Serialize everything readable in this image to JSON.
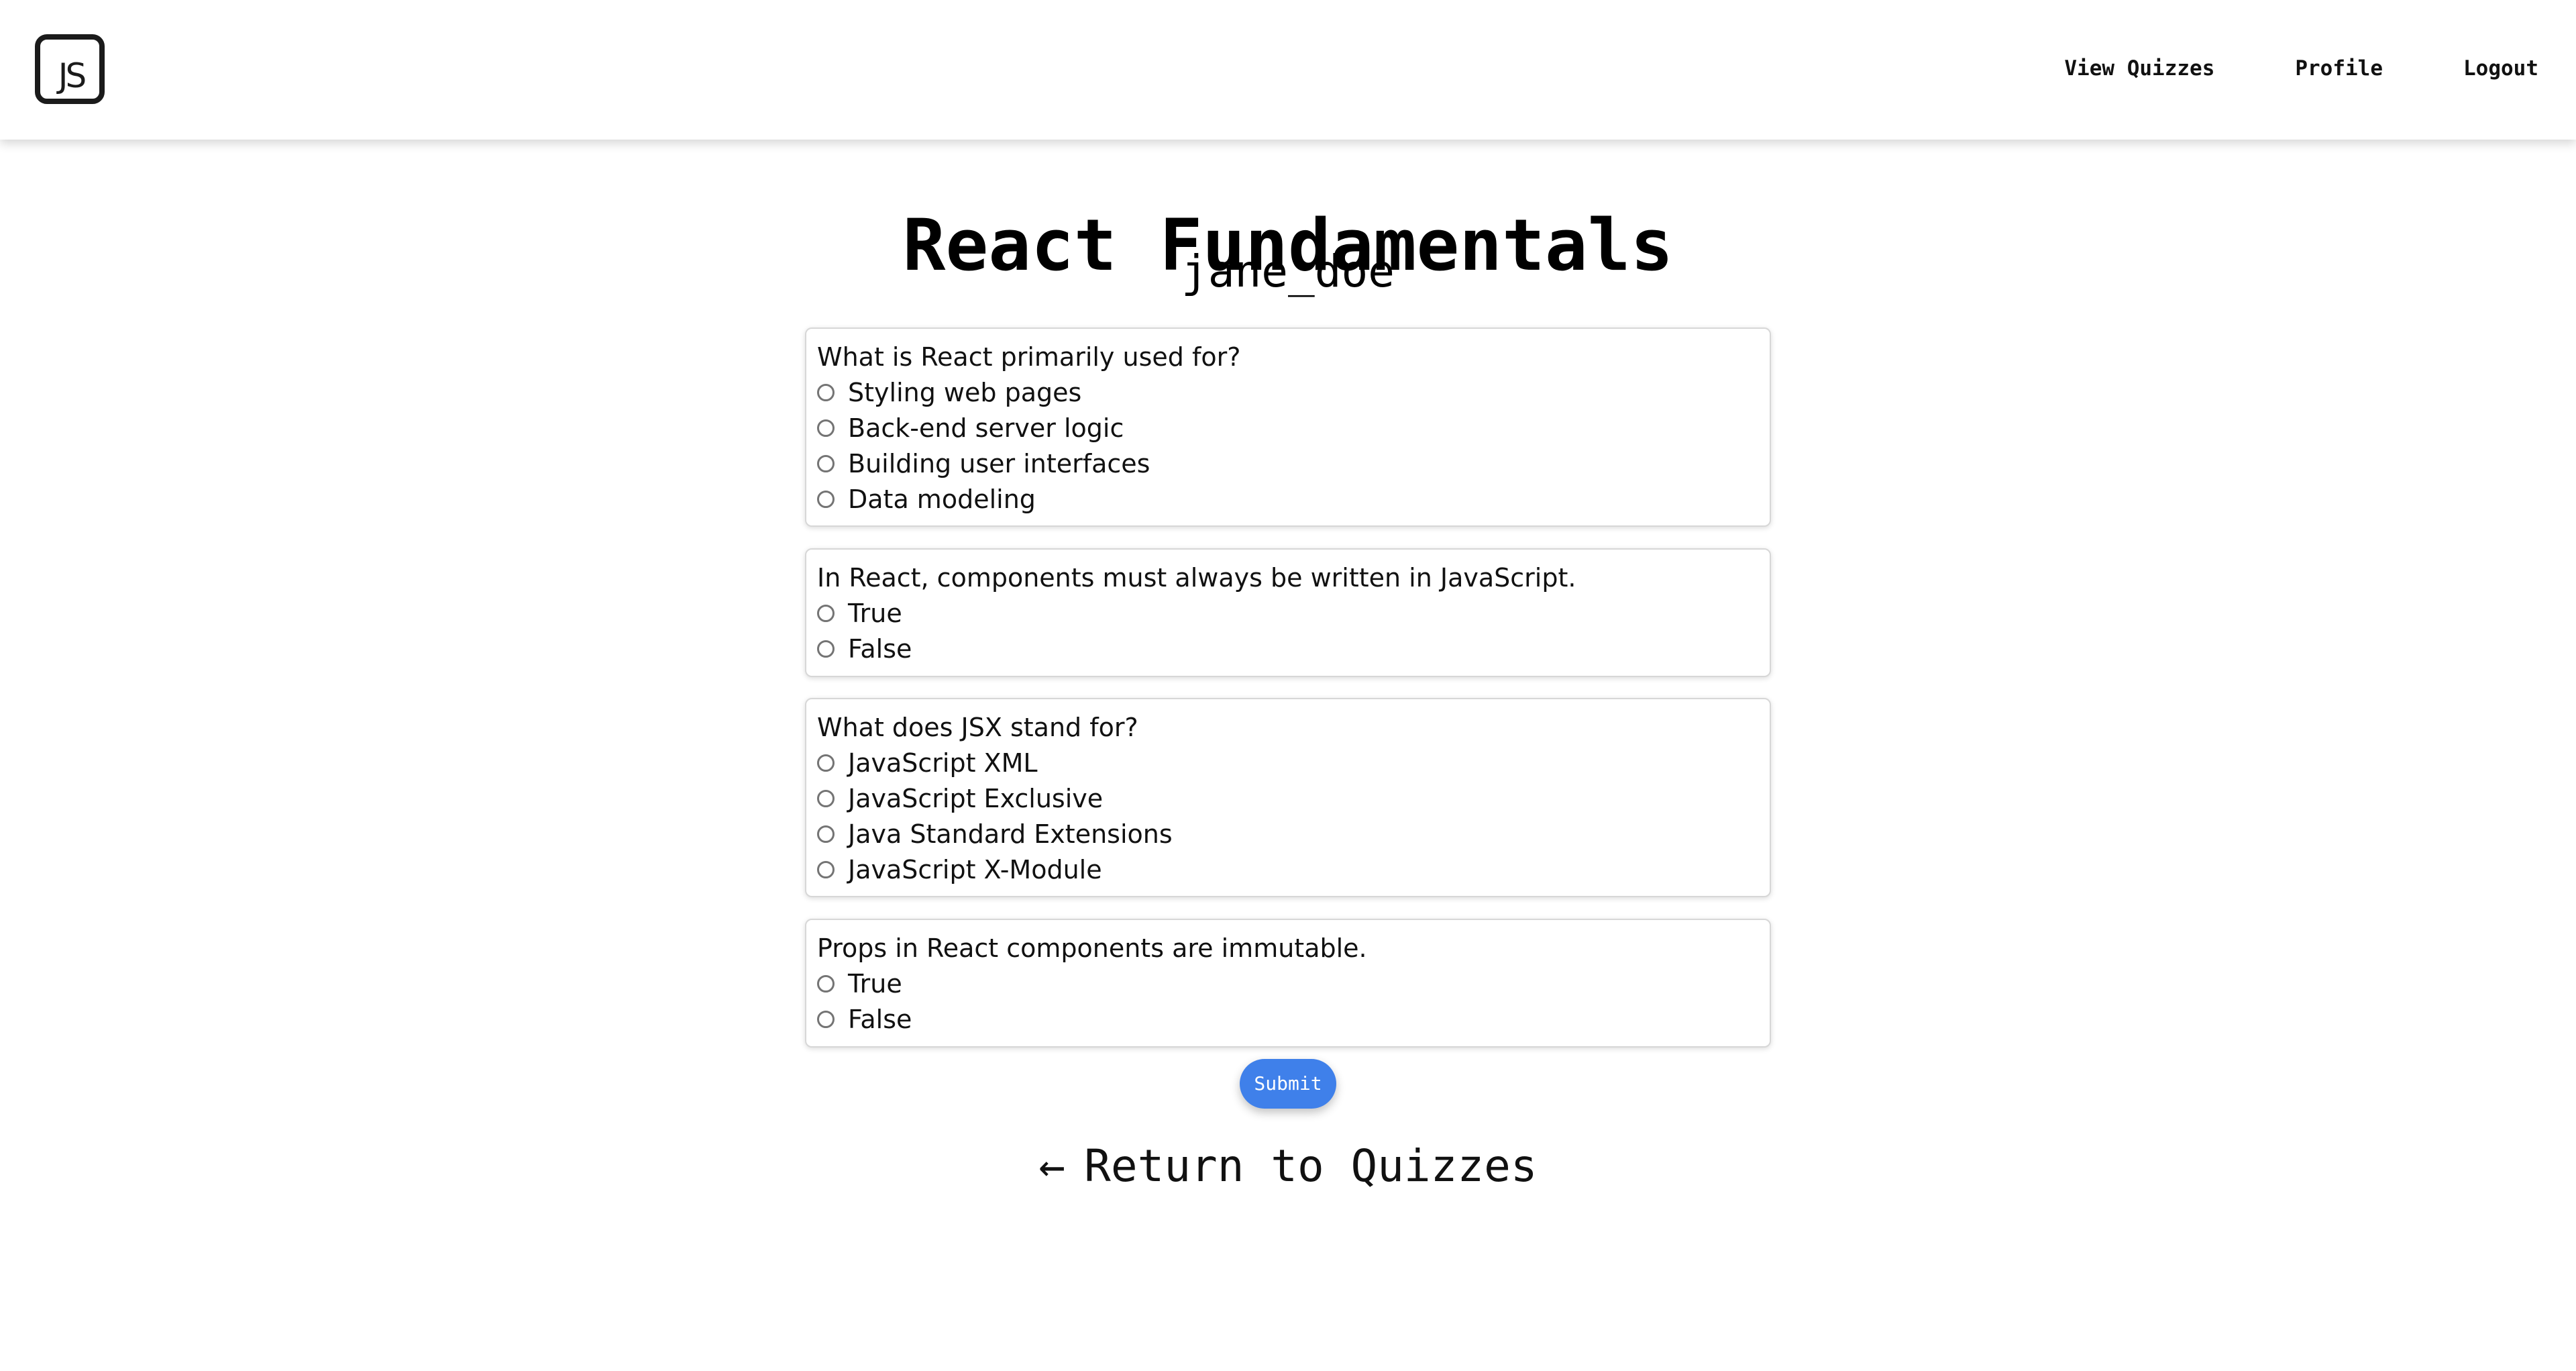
{
  "header": {
    "logo_text": "JS",
    "nav": [
      {
        "label": "View Quizzes",
        "icon": null
      },
      {
        "label": "Profile",
        "icon": null
      },
      {
        "label": "Logout",
        "icon": null
      }
    ]
  },
  "quiz": {
    "title": "React Fundamentals",
    "username": "jane_doe",
    "questions": [
      {
        "text": "What is React primarily used for?",
        "options": [
          "Styling web pages",
          "Back-end server logic",
          "Building user interfaces",
          "Data modeling"
        ]
      },
      {
        "text": "In React, components must always be written in JavaScript.",
        "options": [
          "True",
          "False"
        ]
      },
      {
        "text": "What does JSX stand for?",
        "options": [
          "JavaScript XML",
          "JavaScript Exclusive",
          "Java Standard Extensions",
          "JavaScript X-Module"
        ]
      },
      {
        "text": "Props in React components are immutable.",
        "options": [
          "True",
          "False"
        ]
      }
    ],
    "submit_label": "Submit",
    "return_arrow": "←",
    "return_label": "Return to Quizzes"
  },
  "icons": {
    "logo": "javascript-logo-icon",
    "radio": "radio-button-icon",
    "return": "left-arrow-icon"
  },
  "colors": {
    "accent": "#3f80ea",
    "text": "#111111",
    "card_border": "#d7d7d7",
    "radio_border": "#747474"
  }
}
